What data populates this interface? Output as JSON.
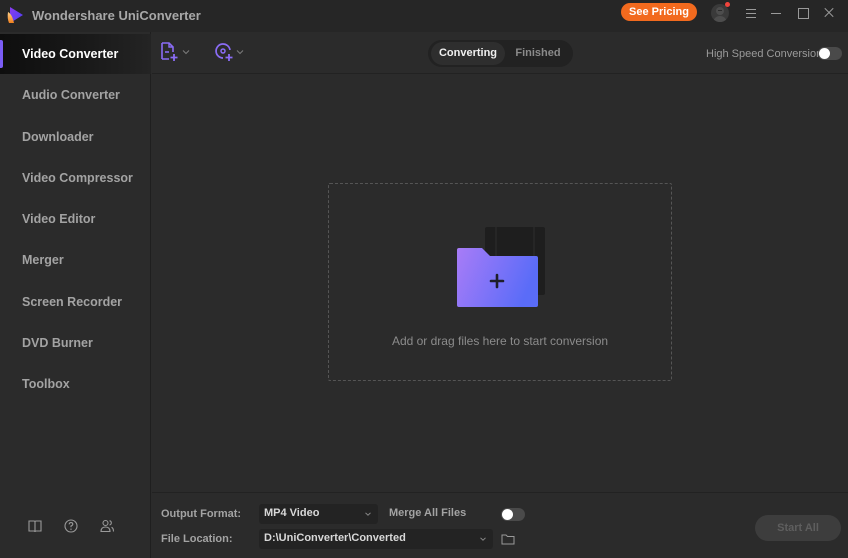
{
  "window": {
    "title": "Wondershare UniConverter",
    "pricing_label": "See Pricing",
    "icons": [
      "app-logo",
      "user-avatar",
      "menu-icon",
      "minimize-icon",
      "maximize-icon",
      "close-icon"
    ]
  },
  "sidebar": {
    "items": [
      {
        "label": "Video Converter",
        "active": true
      },
      {
        "label": "Audio Converter",
        "active": false
      },
      {
        "label": "Downloader",
        "active": false
      },
      {
        "label": "Video Compressor",
        "active": false
      },
      {
        "label": "Video Editor",
        "active": false
      },
      {
        "label": "Merger",
        "active": false
      },
      {
        "label": "Screen Recorder",
        "active": false
      },
      {
        "label": "DVD Burner",
        "active": false
      },
      {
        "label": "Toolbox",
        "active": false
      }
    ],
    "footer_icons": [
      "guide-book-icon",
      "help-icon",
      "community-icon"
    ]
  },
  "toolbar": {
    "add_files_icon": "add-file-icon",
    "add_dvd_icon": "add-disc-icon",
    "tabs": [
      {
        "label": "Converting",
        "active": true
      },
      {
        "label": "Finished",
        "active": false
      }
    ],
    "high_speed_label": "High Speed Conversion",
    "high_speed_enabled": false
  },
  "dropzone": {
    "text": "Add or drag files here to start conversion",
    "icon": "add-folder-icon"
  },
  "bottom": {
    "output_format_label": "Output Format:",
    "output_format_value": "MP4 Video",
    "merge_label": "Merge All Files",
    "merge_enabled": false,
    "file_location_label": "File Location:",
    "file_location_value": "D:\\UniConverter\\Converted",
    "start_all_label": "Start All"
  },
  "colors": {
    "accent": "#7a5cf5",
    "pricing": "#f26a1e",
    "background": "#2b2b2b",
    "titlebar": "#262626"
  }
}
